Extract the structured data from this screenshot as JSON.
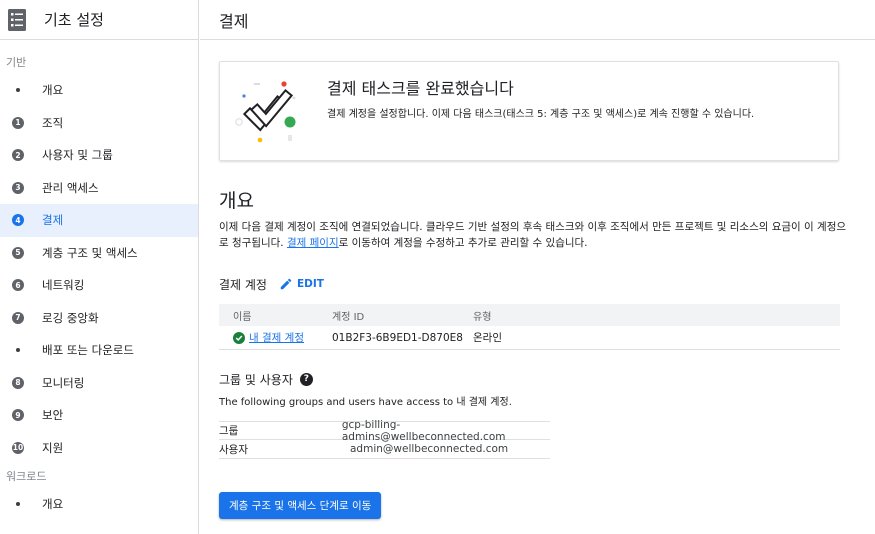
{
  "sidebar": {
    "title": "기초 설정",
    "section_basic": "기반",
    "items": [
      {
        "label": "개요",
        "marker": "dot"
      },
      {
        "label": "조직",
        "marker": "1"
      },
      {
        "label": "사용자 및 그룹",
        "marker": "2"
      },
      {
        "label": "관리 액세스",
        "marker": "3"
      },
      {
        "label": "결제",
        "marker": "4",
        "active": true
      },
      {
        "label": "계층 구조 및 액세스",
        "marker": "5"
      },
      {
        "label": "네트워킹",
        "marker": "6"
      },
      {
        "label": "로깅 중앙화",
        "marker": "7"
      },
      {
        "label": "배포 또는 다운로드",
        "marker": "dot"
      },
      {
        "label": "모니터링",
        "marker": "8"
      },
      {
        "label": "보안",
        "marker": "9"
      },
      {
        "label": "지원",
        "marker": "10"
      }
    ],
    "section_workload": "워크로드",
    "workload_items": [
      {
        "label": "개요",
        "marker": "dot"
      }
    ]
  },
  "header": {
    "title": "결제"
  },
  "card": {
    "heading": "결제 태스크를 완료했습니다",
    "description": "결제 계정을 설정합니다. 이제 다음 태스크(태스크 5: 계층 구조 및 액세스)로 계속 진행할 수 있습니다."
  },
  "overview": {
    "title": "개요",
    "text_before": "이제 다음 결제 계정이 조직에 연결되었습니다. 클라우드 기반 설정의 후속 태스크와 이후 조직에서 만든 프로젝트 및 리소스의 요금이 이 계정으로 청구됩니다. ",
    "link": "결제 페이지",
    "text_after": "로 이동하여 계정을 수정하고 추가로 관리할 수 있습니다."
  },
  "billing_account": {
    "title": "결제 계정",
    "edit_label": "EDIT",
    "columns": [
      "이름",
      "계정 ID",
      "유형"
    ],
    "rows": [
      {
        "name": "내 결제 계정",
        "id": "01B2F3-6B9ED1-D870E8",
        "type": "온라인"
      }
    ]
  },
  "groups_users": {
    "title": "그룹 및 사용자",
    "help_glyph": "?",
    "description": "The following groups and users have access to 내 결제 계정.",
    "rows": [
      {
        "key": "그룹",
        "value": "gcp-billing-admins@wellbeconnected.com"
      },
      {
        "key": "사용자",
        "value": "admin@wellbeconnected.com"
      }
    ]
  },
  "cta_label": "계층 구조 및 액세스 단계로 이동",
  "colors": {
    "accent": "#1a73e8",
    "success": "#188038",
    "active_bg": "#e8f0fe"
  }
}
